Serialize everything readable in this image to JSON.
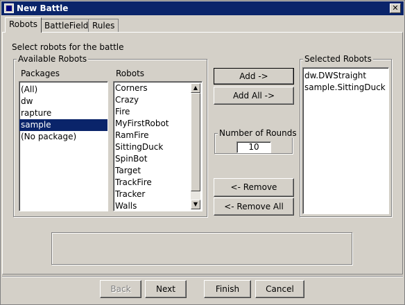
{
  "window": {
    "title": "New Battle",
    "close_glyph": "✕"
  },
  "tabs": [
    {
      "label": "Robots",
      "active": true
    },
    {
      "label": "BattleField",
      "active": false
    },
    {
      "label": "Rules",
      "active": false
    }
  ],
  "instructions": "Select robots for the battle",
  "available": {
    "legend": "Available Robots",
    "packages_header": "Packages",
    "robots_header": "Robots",
    "packages": [
      "(All)",
      "dw",
      "rapture",
      "sample",
      "(No package)"
    ],
    "selected_package": "sample",
    "robots": [
      "Corners",
      "Crazy",
      "Fire",
      "MyFirstRobot",
      "RamFire",
      "SittingDuck",
      "SpinBot",
      "Target",
      "TrackFire",
      "Tracker",
      "Walls"
    ]
  },
  "buttons": {
    "add": "Add ->",
    "add_all": "Add All ->",
    "remove": "<- Remove",
    "remove_all": "<- Remove All"
  },
  "rounds": {
    "legend": "Number of Rounds",
    "value": "10"
  },
  "selected": {
    "legend": "Selected Robots",
    "robots": [
      "dw.DWStraight",
      "sample.SittingDuck"
    ]
  },
  "footer": {
    "back": "Back",
    "next": "Next",
    "finish": "Finish",
    "cancel": "Cancel",
    "back_enabled": false
  },
  "icons": {
    "scroll_up": "▲",
    "scroll_down": "▼"
  }
}
